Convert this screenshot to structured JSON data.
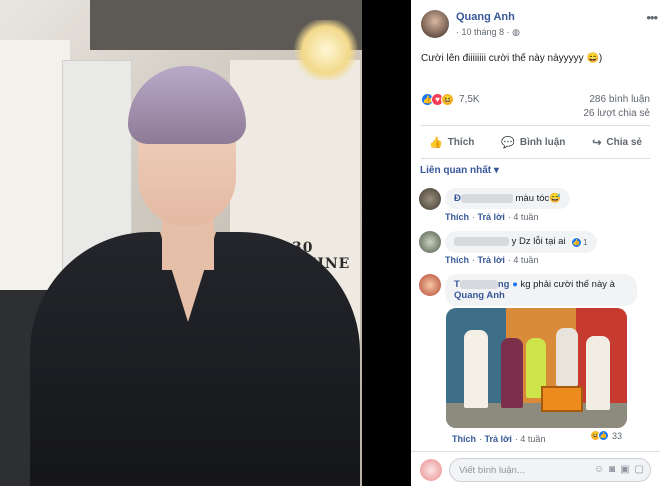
{
  "post": {
    "author": "Quang Anh",
    "date": "10 tháng 8",
    "separator": "·",
    "privacy_icon": "globe-icon",
    "more": "•••",
    "caption": "Cười lên điiiiiiii cười thế này nàyyyyy 😄)",
    "reactions": {
      "icons": [
        "like",
        "love",
        "haha"
      ],
      "count": "7,5K"
    },
    "comments_count": "286 bình luận",
    "shares_count": "26 lượt chia sẻ"
  },
  "actions": {
    "like": "Thích",
    "comment": "Bình luận",
    "share": "Chia sẻ"
  },
  "related_label": "Liên quan nhất ▾",
  "comments": [
    {
      "name_visible": "Đ",
      "text": "màu tóc😅",
      "like": "Thích",
      "reply": "Trả lời",
      "time": "4 tuần"
    },
    {
      "name_visible": "",
      "text": "y Dz lỗi tại ai",
      "reaction_count": "1",
      "like": "Thích",
      "reply": "Trả lời",
      "time": "4 tuần"
    },
    {
      "name_visible": "T",
      "name_suffix": "ng",
      "text": "kg phải cười thế này à",
      "mention": "Quang Anh",
      "like": "Thích",
      "reply": "Trả lời",
      "time": "4 tuần",
      "reaction_count": "33"
    }
  ],
  "reply_placeholder": "Viết bình luận...",
  "photo_sign": "30 SHINE"
}
